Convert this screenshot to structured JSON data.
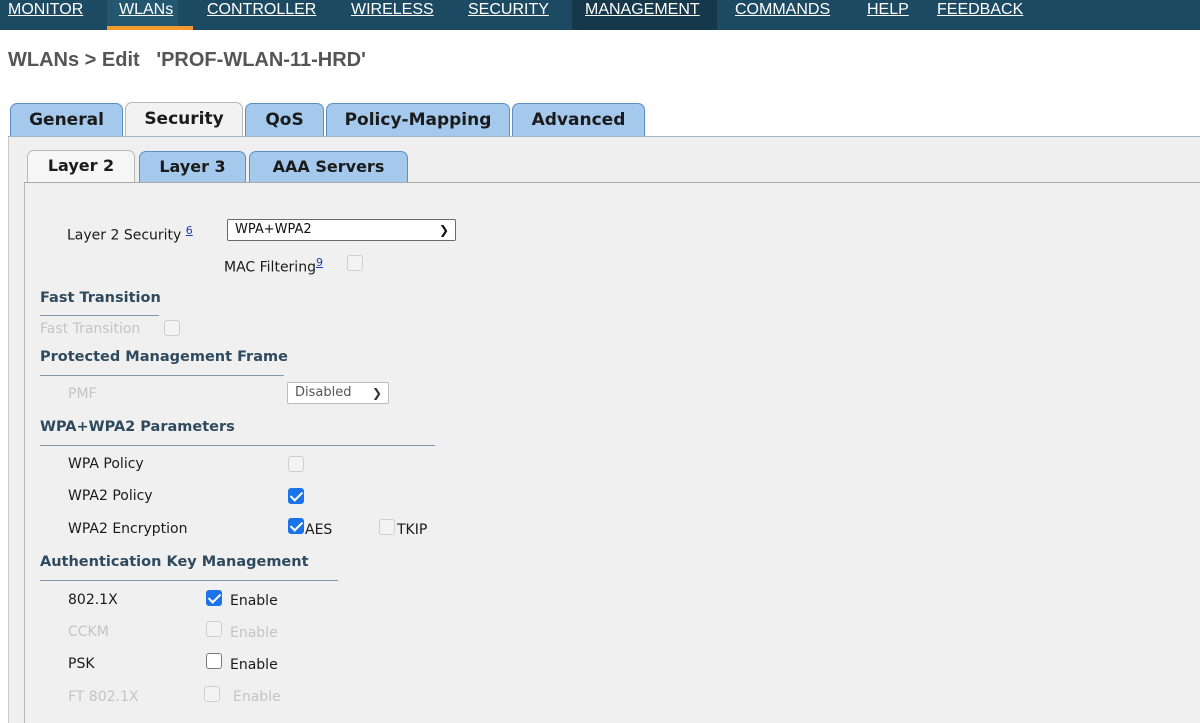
{
  "nav": {
    "items": [
      "MONITOR",
      "WLANs",
      "CONTROLLER",
      "WIRELESS",
      "SECURITY",
      "MANAGEMENT",
      "COMMANDS",
      "HELP",
      "FEEDBACK"
    ]
  },
  "page": {
    "title": "WLANs > Edit   'PROF-WLAN-11-HRD'"
  },
  "tabs": [
    "General",
    "Security",
    "QoS",
    "Policy-Mapping",
    "Advanced"
  ],
  "subtabs": [
    "Layer 2",
    "Layer 3",
    "AAA Servers"
  ],
  "layer2": {
    "security_label": "Layer 2 Security",
    "security_footnote": "6",
    "security_value": "WPA+WPA2",
    "mac_filtering_label": "MAC Filtering",
    "mac_filtering_footnote": "9"
  },
  "fast_transition": {
    "heading": "Fast Transition",
    "label": "Fast Transition"
  },
  "pmf": {
    "heading": "Protected Management Frame",
    "label": "PMF",
    "value": "Disabled"
  },
  "wpa_params": {
    "heading": "WPA+WPA2 Parameters",
    "wpa_policy": "WPA Policy",
    "wpa2_policy": "WPA2 Policy",
    "wpa2_encryption": "WPA2 Encryption",
    "aes": "AES",
    "tkip": "TKIP"
  },
  "akm": {
    "heading": "Authentication Key Management",
    "rows": [
      {
        "label": "802.1X",
        "option": "Enable"
      },
      {
        "label": "CCKM",
        "option": "Enable"
      },
      {
        "label": "PSK",
        "option": "Enable"
      },
      {
        "label": "FT 802.1X",
        "option": "Enable"
      }
    ]
  },
  "colors": {
    "nav_bg": "#1d4a63",
    "nav_active": "#f29a2e",
    "tab_bg": "#a5c9ec",
    "check": "#1a73e8"
  }
}
